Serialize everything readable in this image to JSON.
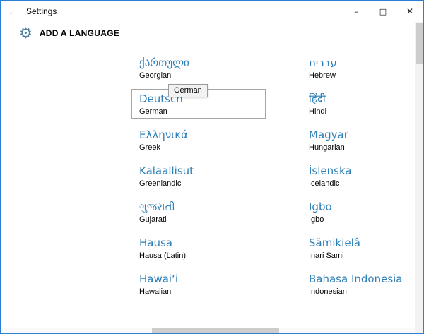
{
  "window": {
    "title": "Settings",
    "controls": {
      "back": "←",
      "minimize": "–",
      "maximize": "□",
      "close": "✕"
    }
  },
  "header": {
    "title": "ADD A LANGUAGE",
    "gear_icon": "⚙"
  },
  "tooltip": {
    "text": "German"
  },
  "languages": {
    "left": [
      {
        "native": "ქართული",
        "english": "Georgian"
      },
      {
        "native": "Deutsch",
        "english": "German",
        "selected": true
      },
      {
        "native": "Ελληνικά",
        "english": "Greek"
      },
      {
        "native": "Kalaallisut",
        "english": "Greenlandic"
      },
      {
        "native": "ગુજરાતી",
        "english": "Gujarati"
      },
      {
        "native": "Hausa",
        "english": "Hausa (Latin)"
      },
      {
        "native": "Hawaiʻi",
        "english": "Hawaiian"
      }
    ],
    "right": [
      {
        "native": "עברית",
        "english": "Hebrew"
      },
      {
        "native": "हिंदी",
        "english": "Hindi"
      },
      {
        "native": "Magyar",
        "english": "Hungarian"
      },
      {
        "native": "Íslenska",
        "english": "Icelandic"
      },
      {
        "native": "Igbo",
        "english": "Igbo"
      },
      {
        "native": "Sämikielâ",
        "english": "Inari Sami"
      },
      {
        "native": "Bahasa Indonesia",
        "english": "Indonesian"
      }
    ]
  },
  "colors": {
    "accent_text": "#2e7fb6",
    "window_border": "#2a7fd4",
    "selected_tile_border": "#a6a6a6",
    "scrollbar_thumb": "#cdcdcd"
  }
}
